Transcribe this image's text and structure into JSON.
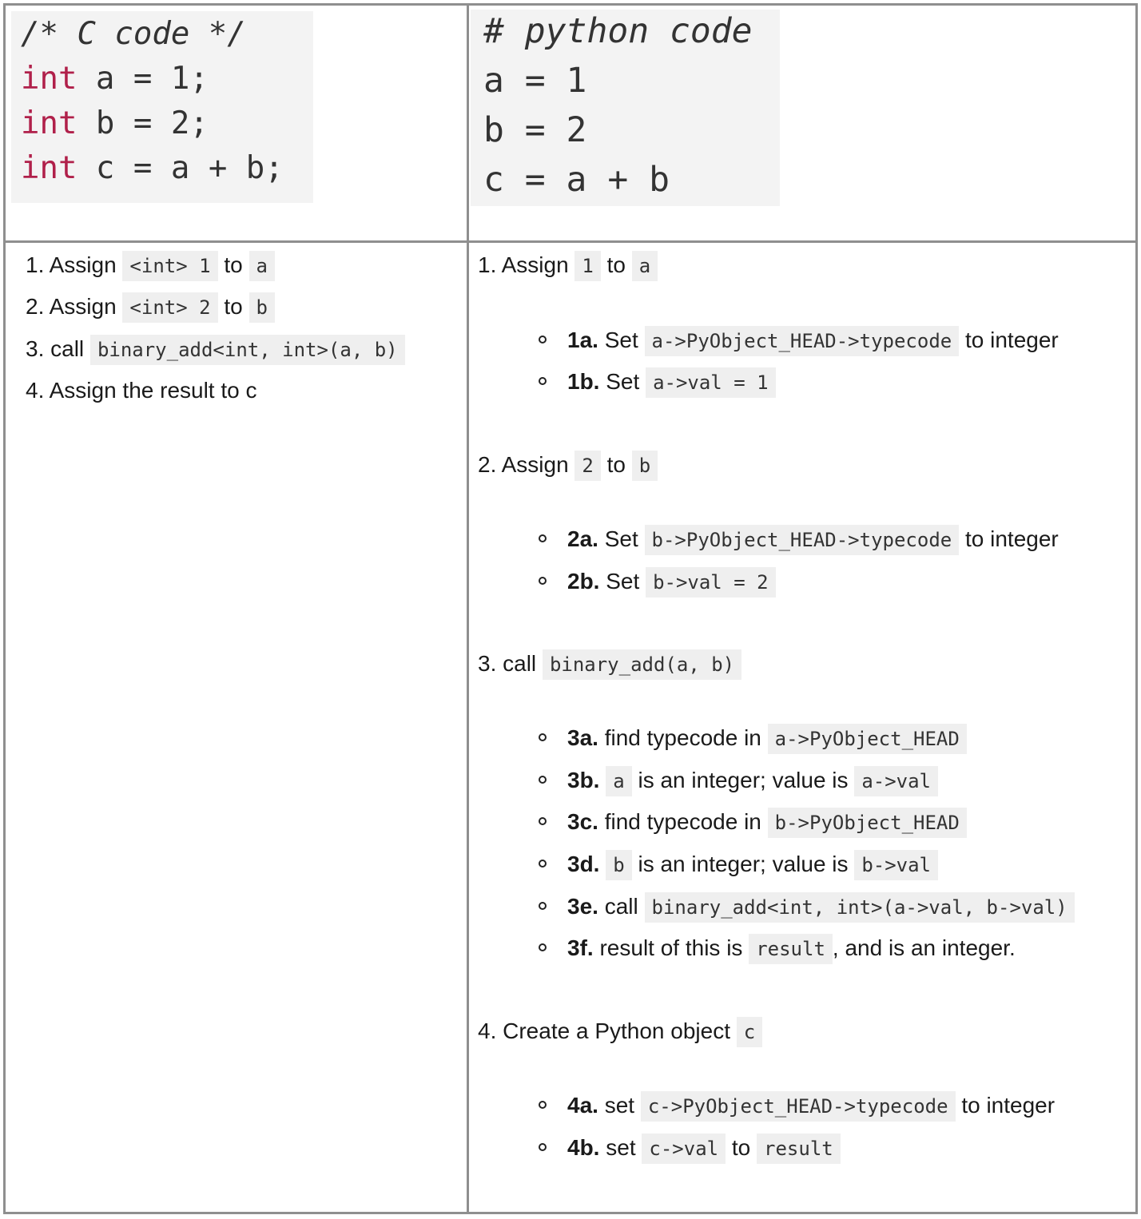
{
  "c_code": {
    "comment": "/* C code */",
    "lines": [
      {
        "kw": "int",
        "rest": " a = 1;"
      },
      {
        "kw": "int",
        "rest": " b = 2;"
      },
      {
        "kw": "int",
        "rest": " c = a + b;"
      }
    ]
  },
  "python_code": {
    "comment": "# python code",
    "lines": [
      "a = 1",
      "b = 2",
      "c = a + b"
    ]
  },
  "c_steps": [
    {
      "n": "1.",
      "verb": "Assign",
      "code1": "<int> 1",
      "mid": "to",
      "code2": "a"
    },
    {
      "n": "2.",
      "verb": "Assign",
      "code1": "<int> 2",
      "mid": "to",
      "code2": "b"
    },
    {
      "n": "3.",
      "verb": "call",
      "code1": "binary_add<int, int>(a, b)"
    },
    {
      "n": "4.",
      "text": "Assign the result to c"
    }
  ],
  "py_steps": {
    "s1": {
      "n": "1.",
      "verb": "Assign",
      "code1": "1",
      "mid": "to",
      "code2": "a"
    },
    "s1a": {
      "label": "1a.",
      "pre": "Set",
      "code": "a->PyObject_HEAD->typecode",
      "post": "to integer"
    },
    "s1b": {
      "label": "1b.",
      "pre": "Set",
      "code": "a->val = 1"
    },
    "s2": {
      "n": "2.",
      "verb": "Assign",
      "code1": "2",
      "mid": "to",
      "code2": "b"
    },
    "s2a": {
      "label": "2a.",
      "pre": "Set",
      "code": "b->PyObject_HEAD->typecode",
      "post": "to integer"
    },
    "s2b": {
      "label": "2b.",
      "pre": "Set",
      "code": "b->val = 2"
    },
    "s3": {
      "n": "3.",
      "verb": "call",
      "code1": "binary_add(a, b)"
    },
    "s3a": {
      "label": "3a.",
      "pre": "find typecode in",
      "code": "a->PyObject_HEAD"
    },
    "s3b": {
      "label": "3b.",
      "code": "a",
      "mid": "is an integer; value is",
      "code2": "a->val"
    },
    "s3c": {
      "label": "3c.",
      "pre": "find typecode in",
      "code": "b->PyObject_HEAD"
    },
    "s3d": {
      "label": "3d.",
      "code": "b",
      "mid": "is an integer; value is",
      "code2": "b->val"
    },
    "s3e": {
      "label": "3e.",
      "pre": "call",
      "code": "binary_add<int, int>(a->val, b->val)"
    },
    "s3f": {
      "label": "3f.",
      "pre": "result of this is",
      "code": "result",
      "post": ", and is an integer."
    },
    "s4": {
      "n": "4.",
      "verb": "Create a Python object",
      "code1": "c"
    },
    "s4a": {
      "label": "4a.",
      "pre": "set",
      "code": "c->PyObject_HEAD->typecode",
      "post": "to integer"
    },
    "s4b": {
      "label": "4b.",
      "pre": "set",
      "code": "c->val",
      "mid": "to",
      "code2": "result"
    }
  }
}
